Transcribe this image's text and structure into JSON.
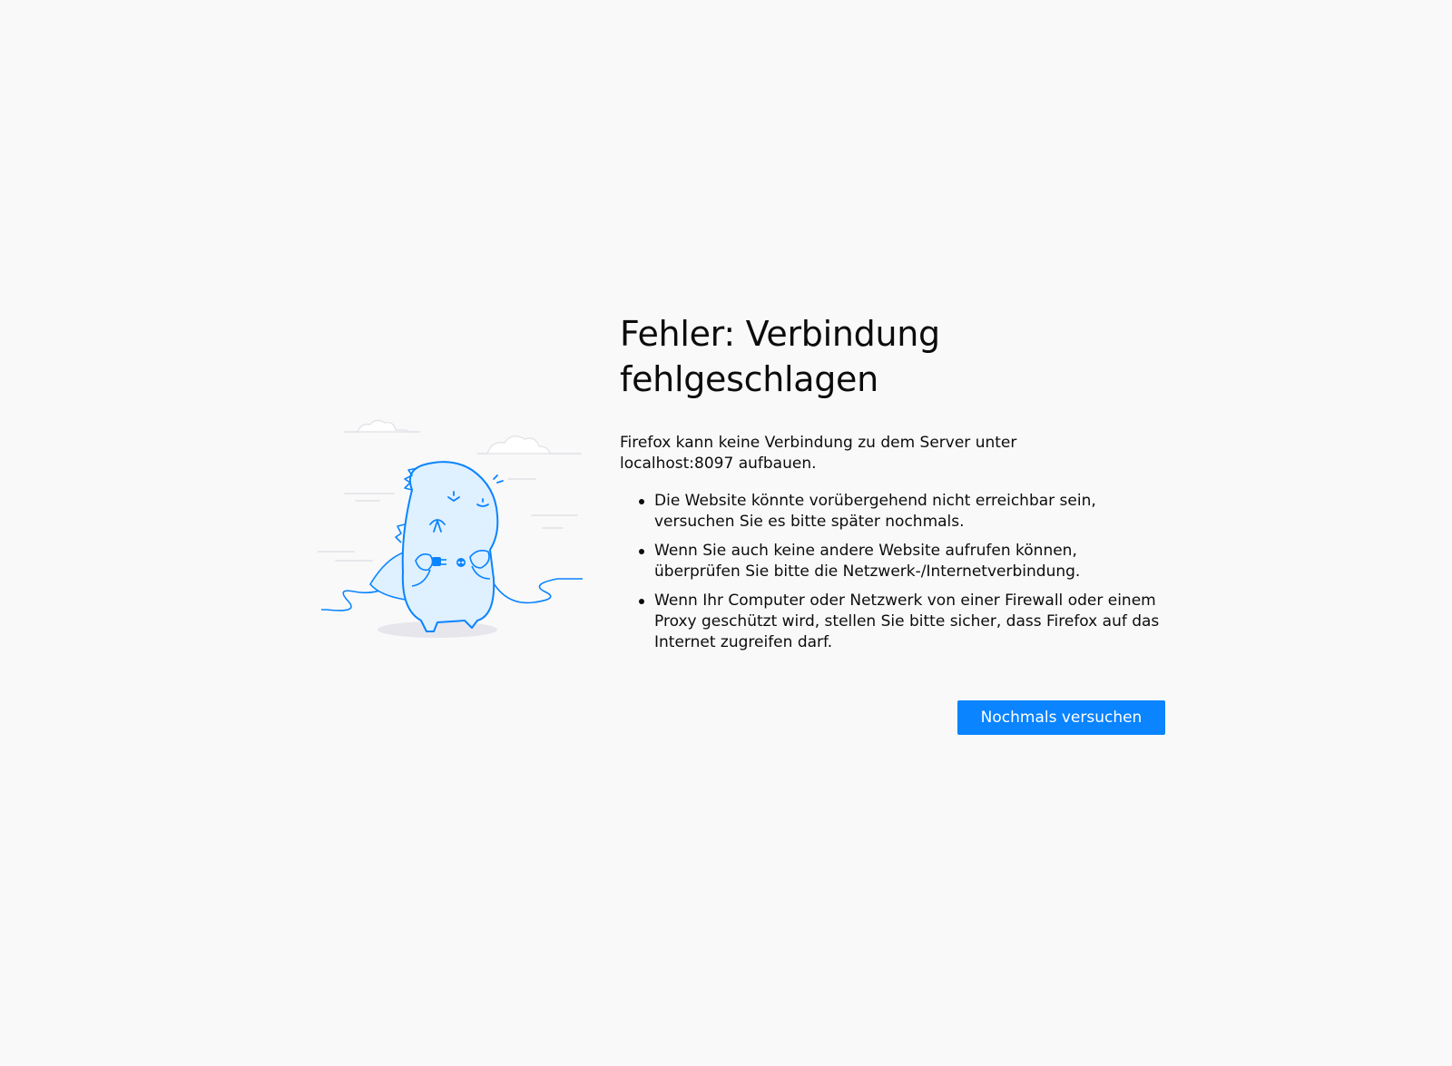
{
  "error": {
    "title_line1": "Fehler: Verbindung",
    "title_line2": "fehlgeschlagen",
    "intro": "Firefox kann keine Verbindung zu dem Server unter localhost:8097 aufbauen.",
    "reasons": [
      "Die Website könnte vorübergehend nicht erreichbar sein, versuchen Sie es bitte später nochmals.",
      "Wenn Sie auch keine andere Website aufrufen können, überprüfen Sie bitte die Netzwerk-/Internetverbindung.",
      "Wenn Ihr Computer oder Netzwerk von einer Firewall oder einem Proxy geschützt wird, stellen Sie bitte sicher, dass Firefox auf das Internet zugreifen darf."
    ],
    "retry_label": "Nochmals versuchen"
  },
  "illustration": {
    "icon": "unplugged-dinosaur-illustration",
    "accent_color": "#0a84ff"
  },
  "colors": {
    "background": "#f9f9fa",
    "button": "#0a84ff",
    "text": "#0c0c0d"
  }
}
